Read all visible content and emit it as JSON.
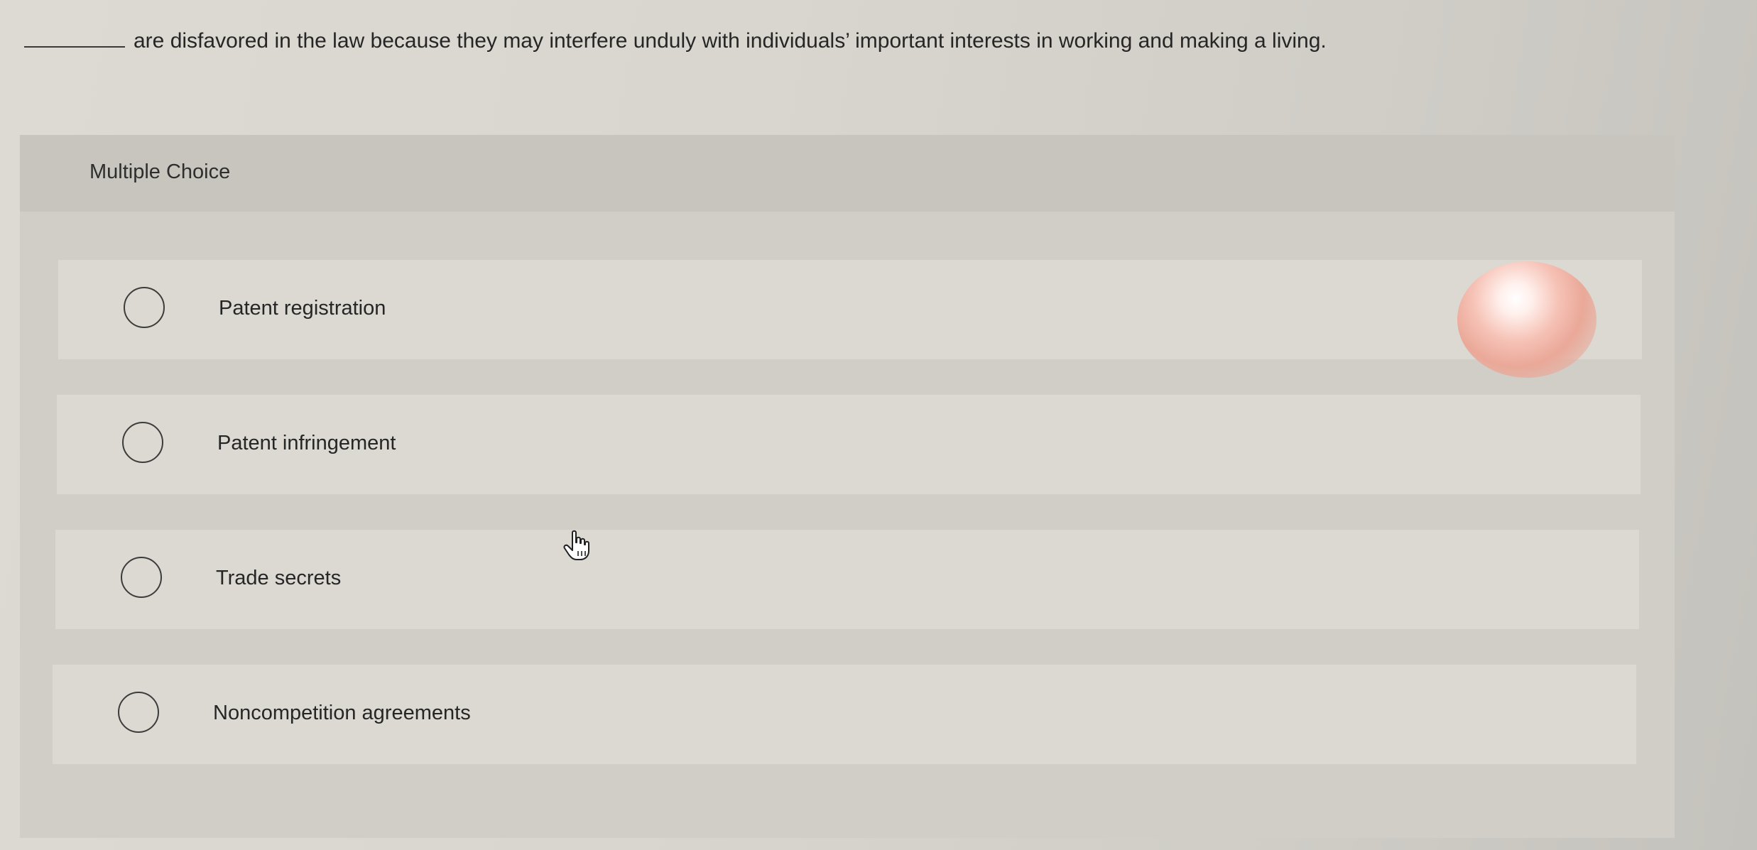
{
  "question": {
    "text": "are disfavored in the law because they may interfere unduly with individuals’ important interests in working and making a living."
  },
  "section": {
    "title": "Multiple Choice"
  },
  "options": [
    {
      "label": "Patent registration"
    },
    {
      "label": "Patent infringement"
    },
    {
      "label": "Trade secrets"
    },
    {
      "label": "Noncompetition agreements"
    }
  ],
  "icons": {
    "cursor": "hand-pointer-icon",
    "radio": "radio-unchecked-icon"
  }
}
